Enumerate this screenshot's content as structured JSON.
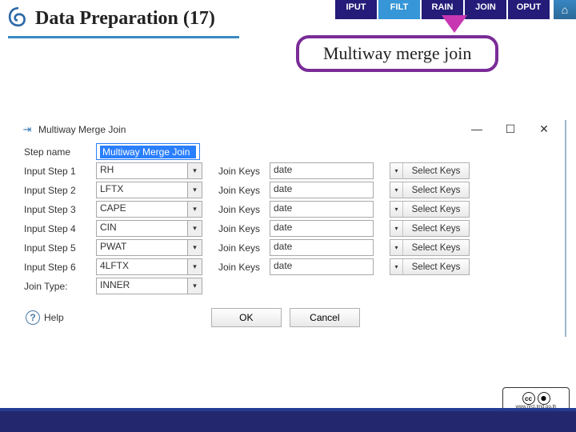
{
  "tabs": [
    "IPUT",
    "FILT",
    "RAIN",
    "JOIN",
    "OPUT"
  ],
  "active_tab_index": 1,
  "page_title": "Data Preparation (17)",
  "callout": "Multiway merge join",
  "dialog": {
    "title": "Multiway Merge Join",
    "step_name_label": "Step name",
    "step_name_value": "Multiway Merge Join",
    "join_keys_label": "Join Keys",
    "select_keys_label": "Select Keys",
    "join_type_label": "Join Type:",
    "join_type_value": "INNER",
    "inputs": [
      {
        "label": "Input Step 1",
        "value": "RH",
        "key": "date"
      },
      {
        "label": "Input Step 2",
        "value": "LFTX",
        "key": "date"
      },
      {
        "label": "Input Step 3",
        "value": "CAPE",
        "key": "date"
      },
      {
        "label": "Input Step 4",
        "value": "CIN",
        "key": "date"
      },
      {
        "label": "Input Step 5",
        "value": "PWAT",
        "key": "date"
      },
      {
        "label": "Input Step 6",
        "value": "4LFTX",
        "key": "date"
      }
    ],
    "help": "Help",
    "ok": "OK",
    "cancel": "Cancel"
  },
  "cc_url": "www.nrct.tmd.go.th"
}
